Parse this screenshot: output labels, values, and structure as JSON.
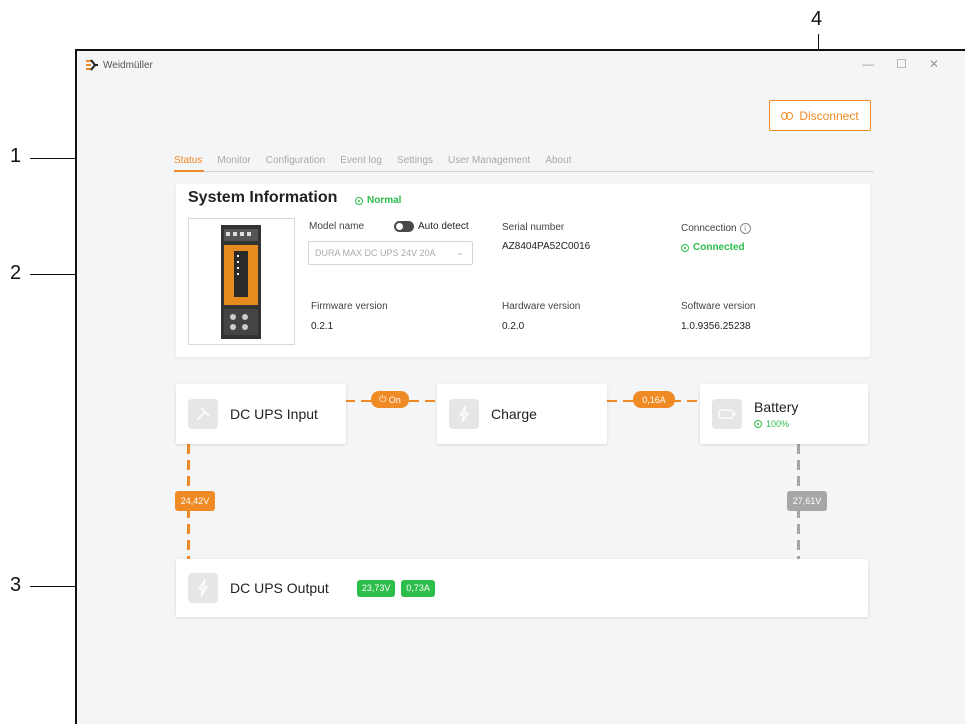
{
  "callouts": [
    "1",
    "2",
    "3",
    "4"
  ],
  "window": {
    "brand": "Weidmüller",
    "controls": {
      "minimize": "—",
      "maximize": "☐",
      "close": "✕"
    }
  },
  "disconnect_label": "Disconnect",
  "tabs": [
    {
      "label": "Status",
      "active": true
    },
    {
      "label": "Monitor"
    },
    {
      "label": "Configuration"
    },
    {
      "label": "Event log"
    },
    {
      "label": "Settings"
    },
    {
      "label": "User Management"
    },
    {
      "label": "About"
    }
  ],
  "system_info": {
    "title": "System Information",
    "status": "Normal",
    "model_name_label": "Model name",
    "auto_detect_label": "Auto detect",
    "model_value": "DURA MAX DC UPS 24V 20A",
    "serial_label": "Serial number",
    "serial_value": "AZ8404PA52C0016",
    "connection_label": "Conncection",
    "connection_value": "Connected",
    "firmware_label": "Firmware version",
    "firmware_value": "0.2.1",
    "hardware_label": "Hardware version",
    "hardware_value": "0.2.0",
    "software_label": "Software version",
    "software_value": "1.0.9356.25238"
  },
  "flow": {
    "input_label": "DC UPS Input",
    "charge_label": "Charge",
    "battery_label": "Battery",
    "battery_status": "100%",
    "output_label": "DC UPS Output",
    "switch_label": "On",
    "charge_current": "0,16A",
    "input_voltage": "24,42V",
    "battery_voltage": "27,61V",
    "output_voltage": "23,73V",
    "output_current": "0,73A"
  },
  "colors": {
    "accent": "#f08a24",
    "ok": "#2dbd4a",
    "muted": "#a6a6a6"
  }
}
